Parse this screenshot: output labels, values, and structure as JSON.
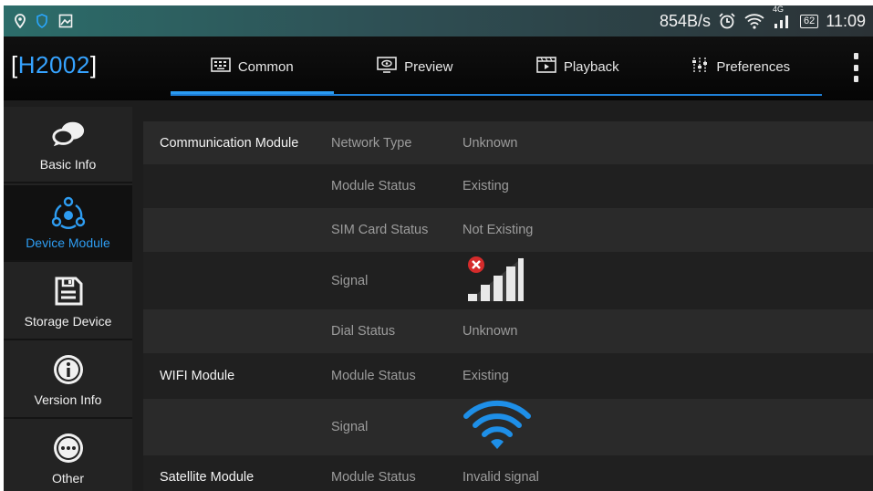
{
  "status_bar": {
    "net_speed": "854B/s",
    "network": "4G",
    "battery": "62",
    "time": "11:09"
  },
  "device": {
    "bracket_open": "[",
    "name": "H2002",
    "bracket_close": "]"
  },
  "tabs": [
    {
      "label": "Common",
      "icon": "keyboard-icon",
      "active": true
    },
    {
      "label": "Preview",
      "icon": "preview-icon",
      "active": false
    },
    {
      "label": "Playback",
      "icon": "playback-icon",
      "active": false
    },
    {
      "label": "Preferences",
      "icon": "sliders-icon",
      "active": false
    }
  ],
  "sidebar": {
    "items": [
      {
        "label": "Basic Info",
        "icon": "chat-bubbles-icon",
        "active": false
      },
      {
        "label": "Device Module",
        "icon": "module-network-icon",
        "active": true
      },
      {
        "label": "Storage Device",
        "icon": "save-disk-icon",
        "active": false
      },
      {
        "label": "Version Info",
        "icon": "info-icon",
        "active": false
      },
      {
        "label": "Other",
        "icon": "more-icon",
        "active": false
      }
    ]
  },
  "rows": [
    {
      "section": "Communication Module",
      "field": "Network Type",
      "value": "Unknown"
    },
    {
      "section": "",
      "field": "Module Status",
      "value": "Existing"
    },
    {
      "section": "",
      "field": "SIM Card Status",
      "value": "Not Existing"
    },
    {
      "section": "",
      "field": "Signal",
      "value": "",
      "icon": "cellular-signal-error-icon"
    },
    {
      "section": "",
      "field": "Dial Status",
      "value": "Unknown"
    },
    {
      "section": "WIFI Module",
      "field": "Module Status",
      "value": "Existing"
    },
    {
      "section": "",
      "field": "Signal",
      "value": "",
      "icon": "wifi-signal-icon"
    },
    {
      "section": "Satellite Module",
      "field": "Module Status",
      "value": "Invalid signal"
    }
  ],
  "colors": {
    "accent": "#2e9df2",
    "device_name": "#36a3ff",
    "wifi_signal": "#1e8fe8",
    "error_badge": "#d52b2b"
  }
}
